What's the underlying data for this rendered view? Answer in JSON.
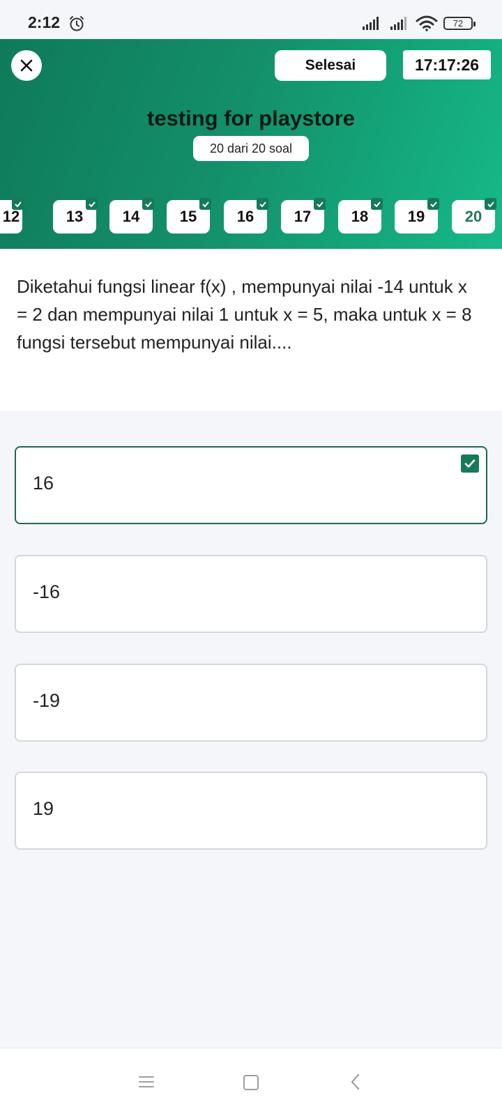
{
  "status_bar": {
    "time": "2:12",
    "battery": "72",
    "icons": [
      "alarm-icon",
      "signal-icon",
      "signal-icon",
      "wifi-icon",
      "battery-icon"
    ]
  },
  "header": {
    "close_icon": "close-icon",
    "finish_label": "Selesai",
    "timer": "17:17:26",
    "title": "testing for playstore",
    "progress": "20 dari 20 soal"
  },
  "question_nav": [
    {
      "label": "12",
      "answered": true
    },
    {
      "label": "13",
      "answered": true
    },
    {
      "label": "14",
      "answered": true
    },
    {
      "label": "15",
      "answered": true
    },
    {
      "label": "16",
      "answered": true
    },
    {
      "label": "17",
      "answered": true
    },
    {
      "label": "18",
      "answered": true
    },
    {
      "label": "19",
      "answered": true
    },
    {
      "label": "20",
      "answered": true,
      "active": true
    }
  ],
  "question": {
    "text": "Diketahui fungsi linear f(x) , mempunyai nilai -14 untuk x = 2 dan mempunyai nilai 1 untuk x = 5, maka untuk x = 8 fungsi tersebut mempunyai nilai...."
  },
  "options": [
    {
      "label": "16",
      "selected": true
    },
    {
      "label": "-16",
      "selected": false
    },
    {
      "label": "-19",
      "selected": false
    },
    {
      "label": "19",
      "selected": false
    }
  ],
  "colors": {
    "accent": "#167a58",
    "header_start": "#0f7a5a",
    "header_end": "#16b989"
  },
  "nav_bar": {
    "icons": [
      "menu-icon",
      "home-icon",
      "back-icon"
    ]
  }
}
